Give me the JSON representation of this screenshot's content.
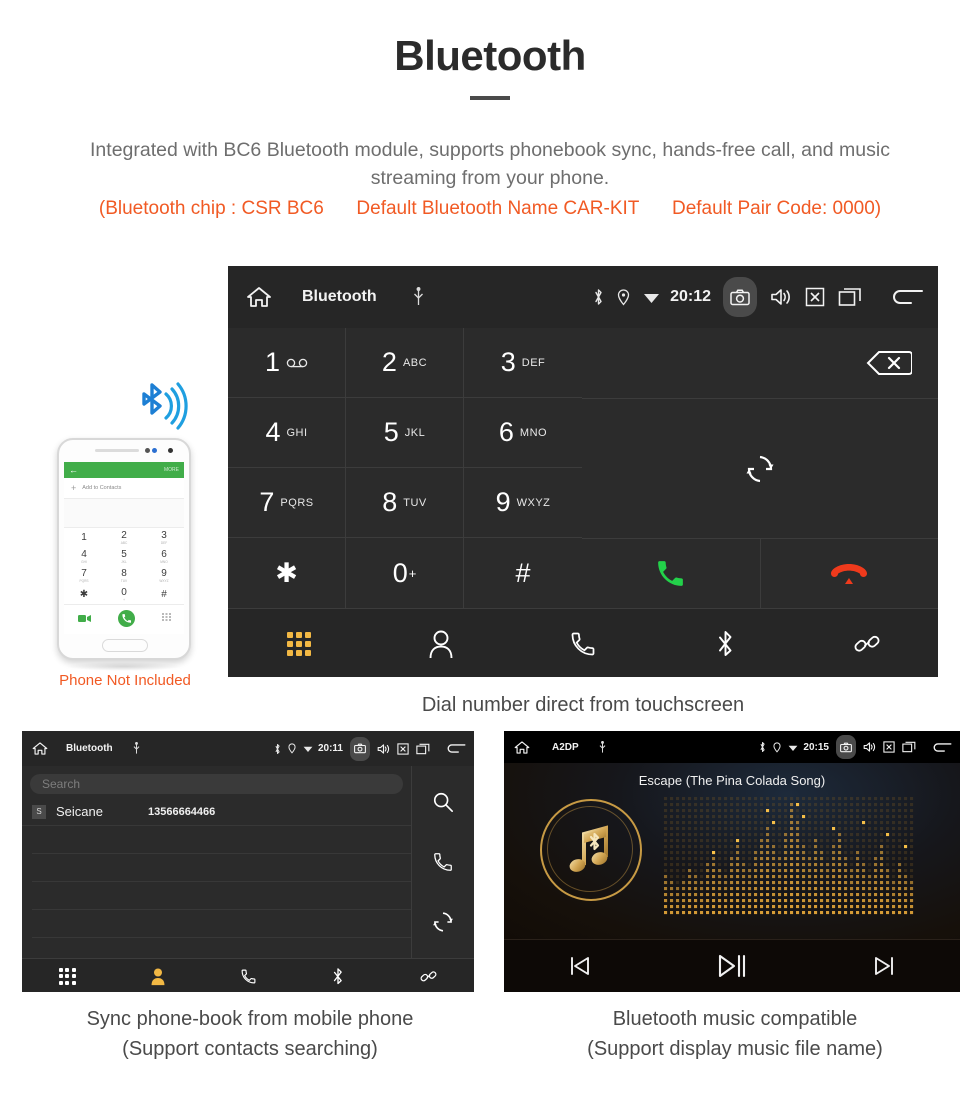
{
  "header": {
    "title": "Bluetooth",
    "description": "Integrated with BC6 Bluetooth module, supports phonebook sync, hands-free call, and music streaming from your phone.",
    "spec_chip": "(Bluetooth chip : CSR BC6",
    "spec_name": "Default Bluetooth Name CAR-KIT",
    "spec_code": "Default Pair Code: 0000)",
    "accent_color": "#f15a24",
    "body_color": "#6e6e6e"
  },
  "phone_mockup": {
    "not_included_label": "Phone Not Included",
    "screen": {
      "back_icon": "←",
      "more_label": "MORE",
      "add_contacts_label": "Add to Contacts",
      "plus_icon": "+",
      "keys": [
        {
          "digit": "1",
          "letters": ""
        },
        {
          "digit": "2",
          "letters": "ABC"
        },
        {
          "digit": "3",
          "letters": "DEF"
        },
        {
          "digit": "4",
          "letters": "GHI"
        },
        {
          "digit": "5",
          "letters": "JKL"
        },
        {
          "digit": "6",
          "letters": "MNO"
        },
        {
          "digit": "7",
          "letters": "PQRS"
        },
        {
          "digit": "8",
          "letters": "TUV"
        },
        {
          "digit": "9",
          "letters": "WXYZ"
        },
        {
          "digit": "✱",
          "letters": ""
        },
        {
          "digit": "0",
          "letters": "+"
        },
        {
          "digit": "#",
          "letters": ""
        }
      ],
      "header_color": "#41ad49"
    }
  },
  "dialer": {
    "statusbar": {
      "title": "Bluetooth",
      "time": "20:12",
      "icons": [
        "home-icon",
        "usb-icon",
        "bluetooth-icon",
        "location-icon",
        "wifi-icon",
        "camera-icon",
        "volume-icon",
        "close-icon",
        "recents-icon",
        "back-icon"
      ]
    },
    "keys": [
      {
        "digit": "1",
        "letters": "",
        "voicemail": true
      },
      {
        "digit": "2",
        "letters": "ABC"
      },
      {
        "digit": "3",
        "letters": "DEF"
      },
      {
        "digit": "4",
        "letters": "GHI"
      },
      {
        "digit": "5",
        "letters": "JKL"
      },
      {
        "digit": "6",
        "letters": "MNO"
      },
      {
        "digit": "7",
        "letters": "PQRS"
      },
      {
        "digit": "8",
        "letters": "TUV"
      },
      {
        "digit": "9",
        "letters": "WXYZ"
      },
      {
        "digit": "✱",
        "letters": ""
      },
      {
        "digit": "0",
        "letters": "+"
      },
      {
        "digit": "#",
        "letters": ""
      }
    ],
    "actions": {
      "backspace": "backspace-icon",
      "sync": "sync-icon",
      "call": "call-button",
      "hangup": "hangup-button",
      "call_color": "#23d14a",
      "hangup_color": "#ef3a1c"
    },
    "navbar": {
      "active": "keypad",
      "active_color": "#f2b844",
      "items": [
        "keypad-tab",
        "contacts-tab",
        "call-log-tab",
        "bluetooth-tab",
        "pair-tab"
      ]
    },
    "caption": "Dial number direct from touchscreen"
  },
  "phonebook": {
    "statusbar": {
      "title": "Bluetooth",
      "time": "20:11"
    },
    "search_placeholder": "Search",
    "contacts": [
      {
        "initial": "S",
        "name": "Seicane",
        "number": "13566664466"
      }
    ],
    "rail": [
      "search-icon",
      "call-icon",
      "sync-icon"
    ],
    "navbar": {
      "active": "contacts",
      "active_color": "#f2b844"
    },
    "caption_line1": "Sync phone-book from mobile phone",
    "caption_line2": "(Support contacts searching)"
  },
  "music": {
    "statusbar": {
      "title": "A2DP",
      "time": "20:15"
    },
    "track_title": "Escape (The Pina Colada Song)",
    "controls": [
      "previous-button",
      "play-pause-button",
      "next-button"
    ],
    "accent_color": "#c79a44",
    "caption_line1": "Bluetooth music compatible",
    "caption_line2": "(Support display music file name)"
  }
}
